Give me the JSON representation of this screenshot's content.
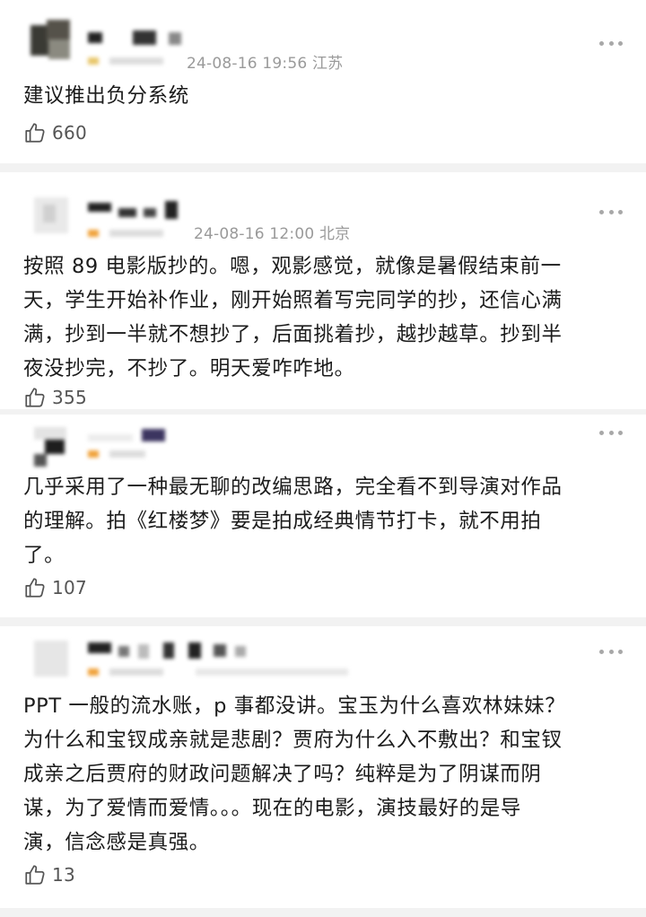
{
  "comments": [
    {
      "date": "24-08-16 19:56",
      "location": "江苏",
      "lines": [
        "建议推出负分系统"
      ],
      "likes": "660"
    },
    {
      "date": "24-08-16 12:00",
      "location": "北京",
      "lines": [
        "按照 89 电影版抄的。嗯，观影感觉，就像是暑假结束前一",
        "天，学生开始补作业，刚开始照着写完同学的抄，还信心满",
        "满，抄到一半就不想抄了，后面挑着抄，越抄越草。抄到半",
        "夜没抄完，不抄了。明天爱咋咋地。"
      ],
      "likes": "355"
    },
    {
      "date": "",
      "location": "",
      "lines": [
        "几乎采用了一种最无聊的改编思路，完全看不到导演对作品",
        "的理解。拍《红楼梦》要是拍成经典情节打卡，就不用拍",
        "了。"
      ],
      "likes": "107"
    },
    {
      "date": "",
      "location": "",
      "lines": [
        "PPT 一般的流水账，p 事都没讲。宝玉为什么喜欢林妹妹？",
        "为什么和宝钗成亲就是悲剧？贾府为什么入不敷出？和宝钗",
        "成亲之后贾府的财政问题解决了吗？纯粹是为了阴谋而阴",
        "谋，为了爱情而爱情。。。现在的电影，演技最好的是导",
        "演，信念感是真强。"
      ],
      "likes": "13"
    }
  ],
  "icons": {
    "like": "thumbs-up-icon",
    "more": "more-dots-icon"
  },
  "colors": {
    "meta": "#9a9a9a",
    "divider": "#f2f2f2",
    "text": "#1c1c1c"
  }
}
